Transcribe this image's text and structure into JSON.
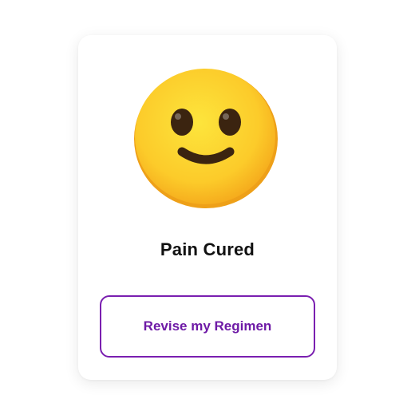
{
  "card": {
    "icon": "slightly-smiling-face-emoji",
    "title": "Pain Cured",
    "button_label": "Revise my Regimen"
  },
  "colors": {
    "accent": "#7a1fb0",
    "emoji_face": "#fcd22e",
    "emoji_rim": "#f0a020"
  }
}
